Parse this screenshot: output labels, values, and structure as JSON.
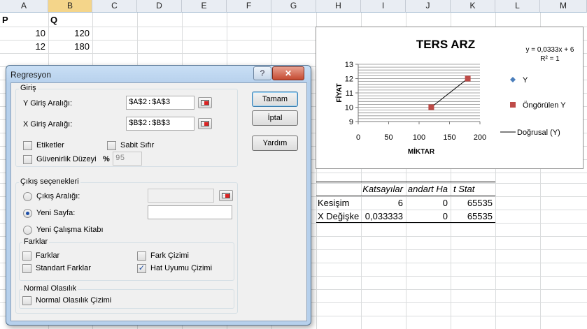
{
  "sheet": {
    "columns": [
      "A",
      "B",
      "C",
      "D",
      "E",
      "F",
      "G",
      "H",
      "I",
      "J",
      "K",
      "L",
      "M"
    ],
    "selected_column": "B",
    "cells": {
      "a1": "P",
      "b1": "Q",
      "a2": "10",
      "b2": "120",
      "a3": "12",
      "b3": "180"
    },
    "results_table": {
      "headers": [
        "Katsayılar",
        "andart Ha",
        "t Stat"
      ],
      "rows": [
        {
          "label": "Kesişim",
          "values": [
            "6",
            "0",
            "65535"
          ]
        },
        {
          "label": "X Değişke",
          "values": [
            "0,033333",
            "0",
            "65535"
          ]
        }
      ]
    }
  },
  "chart_data": {
    "type": "scatter",
    "title": "TERS ARZ",
    "xlabel": "MİKTAR",
    "ylabel": "FİYAT",
    "xlim": [
      0,
      200
    ],
    "ylim": [
      9,
      13
    ],
    "xticks": [
      0,
      50,
      100,
      150,
      200
    ],
    "yticks": [
      9,
      10,
      11,
      12,
      13
    ],
    "grid": true,
    "legend_position": "right",
    "equation": "y = 0,0333x + 6",
    "r_squared": "R² = 1",
    "series": [
      {
        "name": "Y",
        "x": [
          120,
          180
        ],
        "y": [
          10,
          12
        ],
        "color": "#4a7ebb",
        "marker": "diamond"
      },
      {
        "name": "Öngörülen Y",
        "x": [
          120,
          180
        ],
        "y": [
          10,
          12
        ],
        "color": "#be4b48",
        "marker": "square"
      },
      {
        "name": "Doğrusal (Y)",
        "x": [
          120,
          180
        ],
        "y": [
          10,
          12
        ],
        "color": "#000000",
        "marker": "line"
      }
    ]
  },
  "dialog": {
    "title": "Regresyon",
    "help_label": "?",
    "close_label": "✕",
    "input_group": "Giriş",
    "y_range_label": "Y Giriş Aralığı:",
    "y_range_value": "$A$2:$A$3",
    "x_range_label": "X Giriş Aralığı:",
    "x_range_value": "$B$2:$B$3",
    "labels_label": "Etiketler",
    "constant_zero_label": "Sabit Sıfır",
    "confidence_label": "Güvenirlik Düzeyi",
    "confidence_percent": "%",
    "confidence_value": "95",
    "output_group": "Çıkış seçenekleri",
    "output_range_label": "Çıkış Aralığı:",
    "new_sheet_label": "Yeni Sayfa:",
    "new_workbook_label": "Yeni Çalışma Kitabı",
    "residuals_group": "Farklar",
    "residuals_label": "Farklar",
    "residual_plots_label": "Fark Çizimi",
    "standard_residuals_label": "Standart Farklar",
    "line_fit_label": "Hat Uyumu Çizimi",
    "normal_group": "Normal Olasılık",
    "normal_plot_label": "Normal Olasılık Çizimi",
    "ok_label": "Tamam",
    "cancel_label": "İptal",
    "help_btn_label": "Yardım",
    "checkmark": "✓"
  },
  "colors": {
    "series_y": "#4a7ebb",
    "series_pred": "#be4b48"
  }
}
